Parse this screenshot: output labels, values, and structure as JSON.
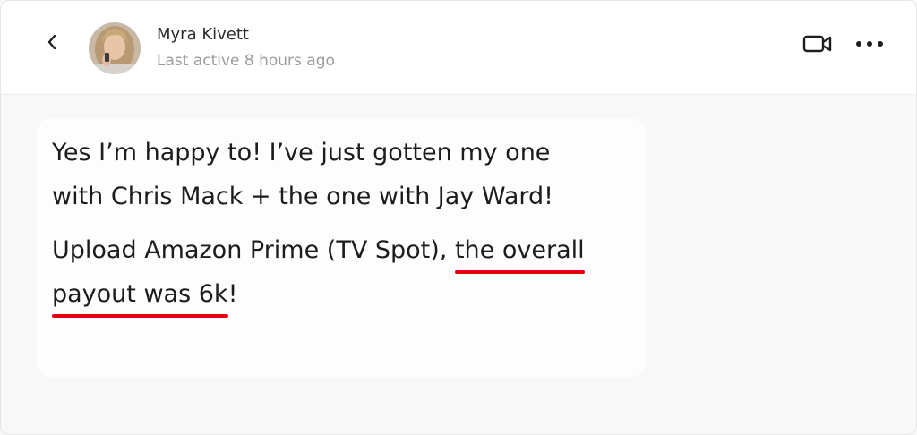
{
  "header": {
    "contact_name": "Myra Kivett",
    "status": "Last active 8 hours ago"
  },
  "icons": {
    "back": "chevron-left-icon",
    "video": "video-camera-icon",
    "more": "more-horizontal-icon"
  },
  "message": {
    "line1": "Yes I’m happy to!  I’ve just gotten my one",
    "line2": "with Chris Mack + the one with Jay Ward!",
    "line3_plain": "Upload Amazon Prime (TV Spot), ",
    "line3_underlined": "the overall",
    "line4_underlined": "payout was 6k",
    "line4_tail": "!"
  },
  "colors": {
    "underline": "#e3000f",
    "status_text": "#9b9b9b"
  }
}
